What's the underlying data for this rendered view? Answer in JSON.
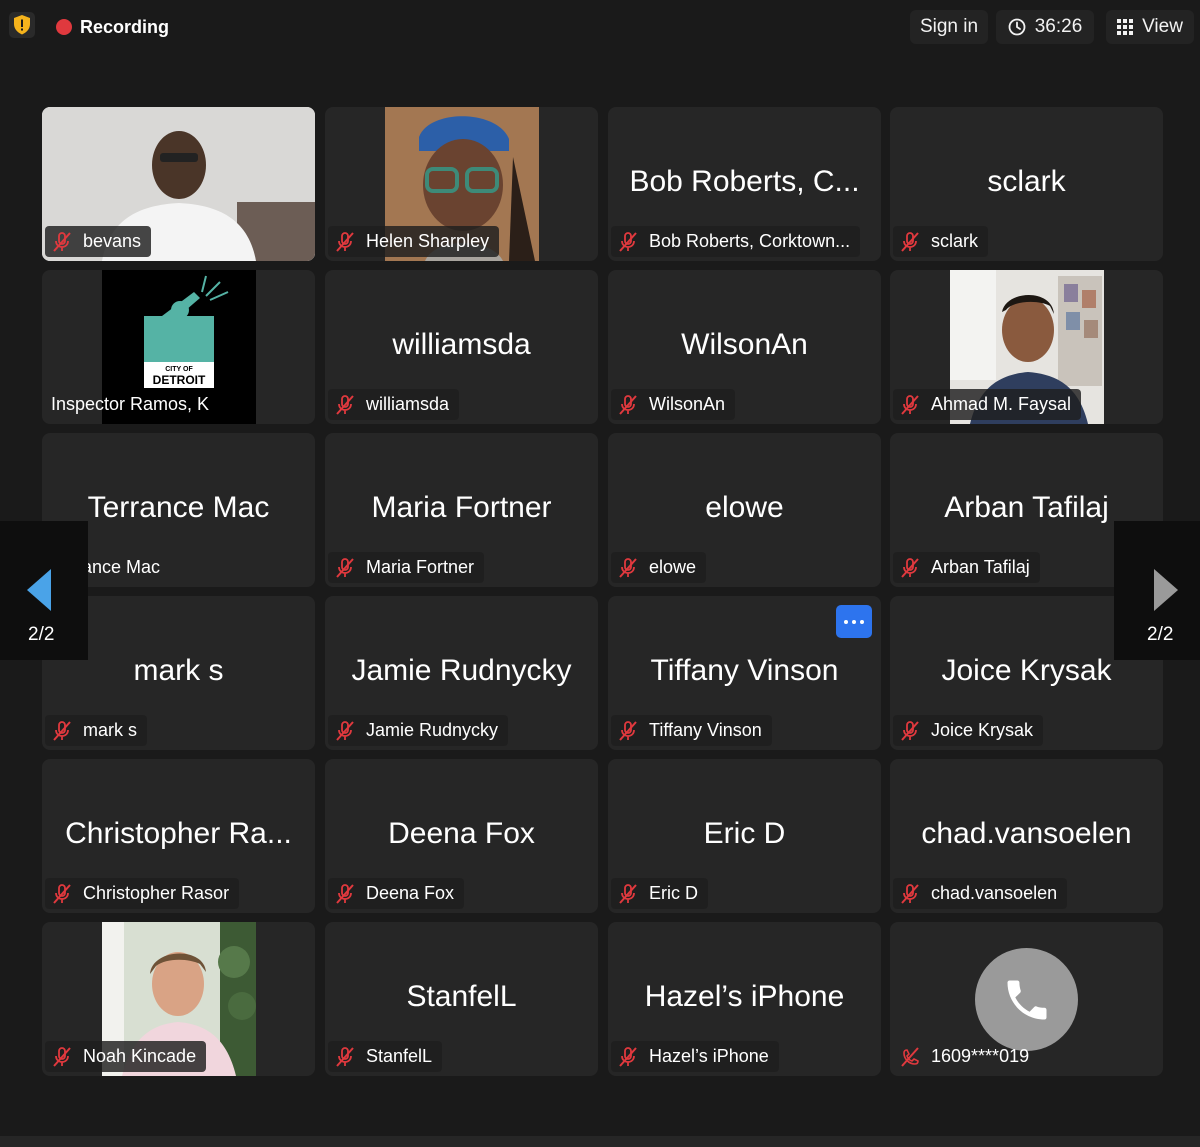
{
  "topbar": {
    "recording_label": "Recording",
    "sign_in_label": "Sign in",
    "timer": "36:26",
    "view_label": "View"
  },
  "pager": {
    "left_label": "2/2",
    "right_label": "2/2"
  },
  "tiles": [
    {
      "name": "",
      "label": "bevans"
    },
    {
      "name": "",
      "label": "Helen Sharpley"
    },
    {
      "name": "Bob Roberts, C...",
      "label": "Bob Roberts, Corktown..."
    },
    {
      "name": "sclark",
      "label": "sclark"
    },
    {
      "name": "",
      "label": "Inspector Ramos, K",
      "logo_top": "CITY OF",
      "logo_bottom": "DETROIT"
    },
    {
      "name": "williamsda",
      "label": "williamsda"
    },
    {
      "name": "WilsonAn",
      "label": "WilsonAn"
    },
    {
      "name": "",
      "label": "Ahmad M. Faysal"
    },
    {
      "name": "Terrance Mac",
      "label": "Terrance Mac"
    },
    {
      "name": "Maria Fortner",
      "label": "Maria Fortner"
    },
    {
      "name": "elowe",
      "label": "elowe"
    },
    {
      "name": "Arban Tafilaj",
      "label": "Arban Tafilaj"
    },
    {
      "name": "mark s",
      "label": "mark s"
    },
    {
      "name": "Jamie Rudnycky",
      "label": "Jamie Rudnycky"
    },
    {
      "name": "Tiffany Vinson",
      "label": "Tiffany Vinson"
    },
    {
      "name": "Joice Krysak",
      "label": "Joice Krysak"
    },
    {
      "name": "Christopher Ra...",
      "label": "Christopher Rasor"
    },
    {
      "name": "Deena Fox",
      "label": "Deena Fox"
    },
    {
      "name": "Eric D",
      "label": "Eric D"
    },
    {
      "name": "chad.vansoelen",
      "label": "chad.vansoelen"
    },
    {
      "name": "",
      "label": "Noah Kincade"
    },
    {
      "name": "StanfelL",
      "label": "StanfelL"
    },
    {
      "name": "Hazel’s iPhone",
      "label": "Hazel’s iPhone"
    },
    {
      "name": "",
      "label": "1609****019"
    }
  ],
  "colors": {
    "background": "#1a1a1a",
    "tile": "#262626",
    "muted_mic": "#e0393e",
    "accent_blue": "#2d74ee",
    "pager_arrow_left": "#4aa3e8",
    "shield": "#f5b31c"
  },
  "icons": {
    "security": "shield-icon",
    "recording": "record-dot-icon",
    "timer": "clock-icon",
    "view": "grid-icon",
    "muted": "mic-muted-icon",
    "phone": "phone-icon",
    "more": "more-dots-icon"
  }
}
